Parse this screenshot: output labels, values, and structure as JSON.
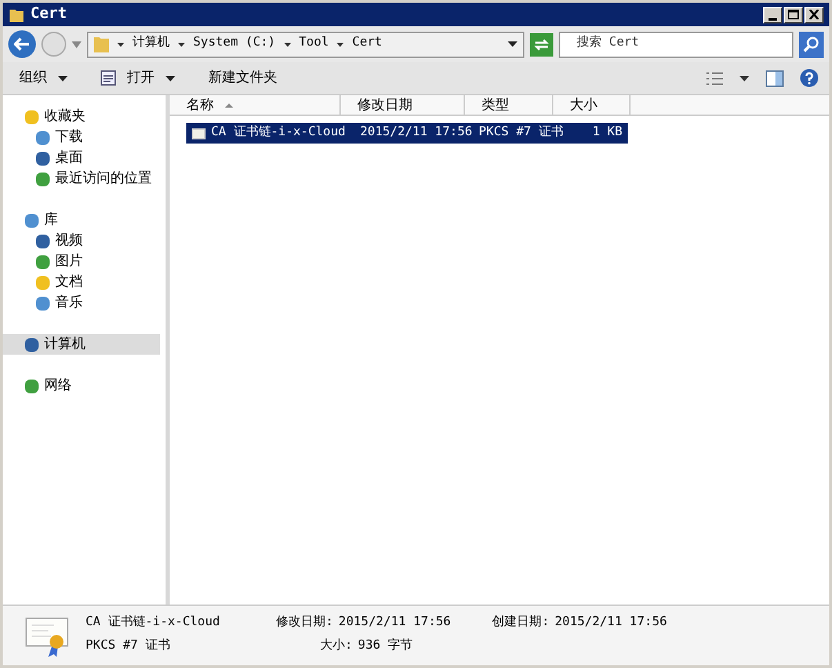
{
  "window": {
    "title": "Cert"
  },
  "address": {
    "path": [
      "计算机",
      "System (C:)",
      "Tool",
      "Cert"
    ]
  },
  "search": {
    "placeholder": "搜索 Cert"
  },
  "toolbar": {
    "items": [
      {
        "label": "组织",
        "dropdown": true
      },
      {
        "label": "打开",
        "dropdown": true
      },
      {
        "label": "新建文件夹",
        "dropdown": false
      }
    ]
  },
  "sidebar": {
    "items": [
      {
        "label": "收藏夹",
        "selected": false,
        "children": [
          {
            "label": "下载",
            "selected": false
          },
          {
            "label": "桌面",
            "selected": false
          },
          {
            "label": "最近访问的位置",
            "selected": false
          }
        ]
      },
      {
        "label": "库",
        "selected": false,
        "children": [
          {
            "label": "视频",
            "selected": false
          },
          {
            "label": "图片",
            "selected": false
          },
          {
            "label": "文档",
            "selected": false
          },
          {
            "label": "音乐",
            "selected": false
          }
        ]
      },
      {
        "label": "计算机",
        "selected": true
      },
      {
        "label": "网络",
        "selected": false
      }
    ]
  },
  "table": {
    "columns": [
      "名称",
      "修改日期",
      "类型",
      "大小"
    ],
    "rows": [
      {
        "cells": [
          "CA 证书链-i-x-Cloud",
          "2015/2/11 17:56",
          "PKCS #7 证书",
          "1 KB"
        ],
        "selected": true
      }
    ]
  },
  "details": {
    "name": "CA 证书链-i-x-Cloud",
    "type": "PKCS #7 证书",
    "fields": [
      {
        "label": "修改日期:",
        "value": "2015/2/11 17:56"
      },
      {
        "label": "创建日期:",
        "value": "2015/2/11 17:56"
      },
      {
        "label": "大小:",
        "value": "936 字节"
      }
    ]
  }
}
